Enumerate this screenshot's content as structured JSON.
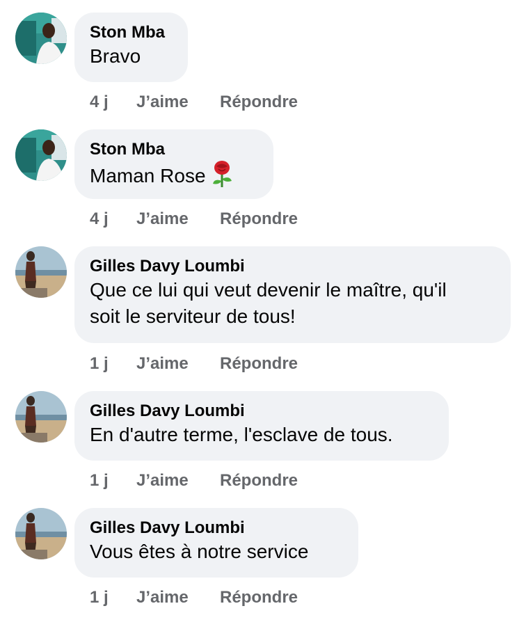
{
  "comments": [
    {
      "author": "Ston Mba",
      "text": "Bravo",
      "time": "4 j",
      "like_label": "J’aime",
      "reply_label": "Répondre"
    },
    {
      "author": "Ston Mba",
      "text": "Maman Rose",
      "emoji": "rose-icon",
      "time": "4 j",
      "like_label": "J’aime",
      "reply_label": "Répondre"
    },
    {
      "author": "Gilles Davy Loumbi",
      "text_line1": "Que ce lui qui veut devenir le maître, qu'il",
      "text_line2": "soit le serviteur de tous!",
      "time": "1 j",
      "like_label": "J’aime",
      "reply_label": "Répondre"
    },
    {
      "author": "Gilles Davy Loumbi",
      "text": "En d'autre terme, l'esclave de tous.",
      "time": "1 j",
      "like_label": "J’aime",
      "reply_label": "Répondre"
    },
    {
      "author": "Gilles Davy Loumbi",
      "text": "Vous êtes à notre service",
      "time": "1 j",
      "like_label": "J’aime",
      "reply_label": "Répondre"
    }
  ],
  "colors": {
    "bubble": "#f0f2f5",
    "meta_text": "#65676b",
    "primary_text": "#050505"
  }
}
